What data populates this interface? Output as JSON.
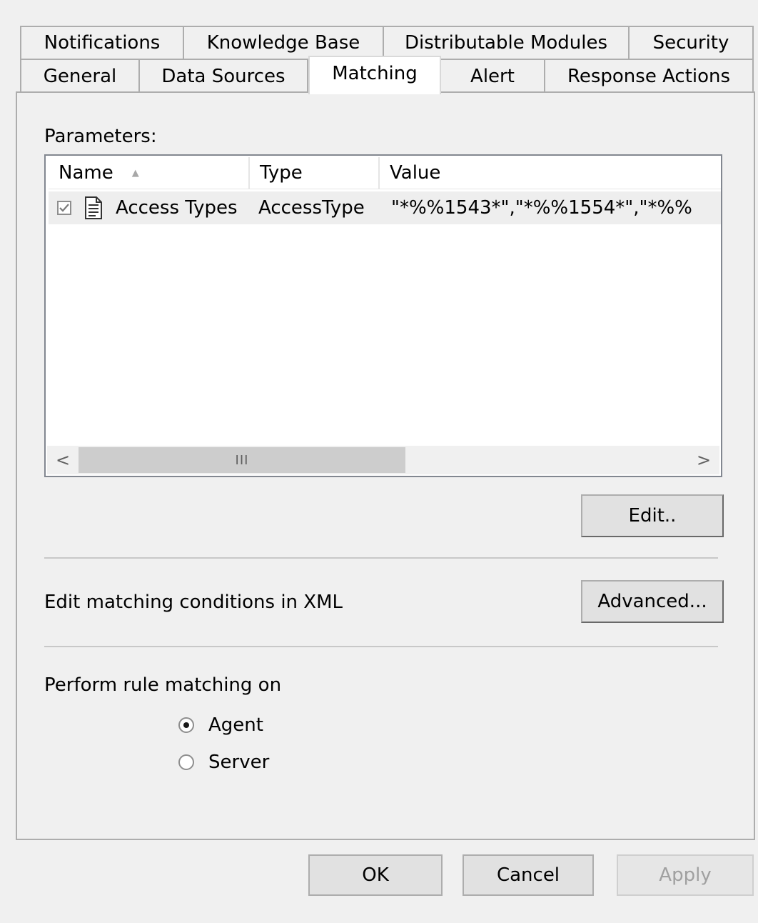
{
  "tabs": {
    "row1": [
      {
        "label": "Notifications"
      },
      {
        "label": "Knowledge Base"
      },
      {
        "label": "Distributable Modules"
      },
      {
        "label": "Security"
      }
    ],
    "row2": [
      {
        "label": "General"
      },
      {
        "label": "Data Sources"
      },
      {
        "label": "Matching",
        "selected": true
      },
      {
        "label": "Alert"
      },
      {
        "label": "Response Actions"
      }
    ]
  },
  "parameters": {
    "label": "Parameters:",
    "columns": [
      {
        "label": "Name",
        "sort_indicator": "▲"
      },
      {
        "label": "Type"
      },
      {
        "label": "Value"
      }
    ],
    "rows": [
      {
        "checked": true,
        "icon": "document-icon",
        "name": "Access Types",
        "type": "AccessType",
        "value": "\"*%%1543*\",\"*%%1554*\",\"*%%"
      }
    ],
    "scrollbar": {
      "left": "<",
      "right": ">",
      "thumb_grip": "III"
    }
  },
  "edit_button": "Edit..",
  "xml_section": {
    "label": "Edit matching conditions in XML",
    "advanced_button": "Advanced..."
  },
  "rule_matching": {
    "label": "Perform rule matching on",
    "options": [
      {
        "label": "Agent",
        "checked": true
      },
      {
        "label": "Server",
        "checked": false
      }
    ]
  },
  "footer": {
    "ok": "OK",
    "cancel": "Cancel",
    "apply": "Apply"
  },
  "colors": {
    "window_bg": "#f0f0f0",
    "list_row_bg": "#eeeeee",
    "border": "#adadad"
  }
}
